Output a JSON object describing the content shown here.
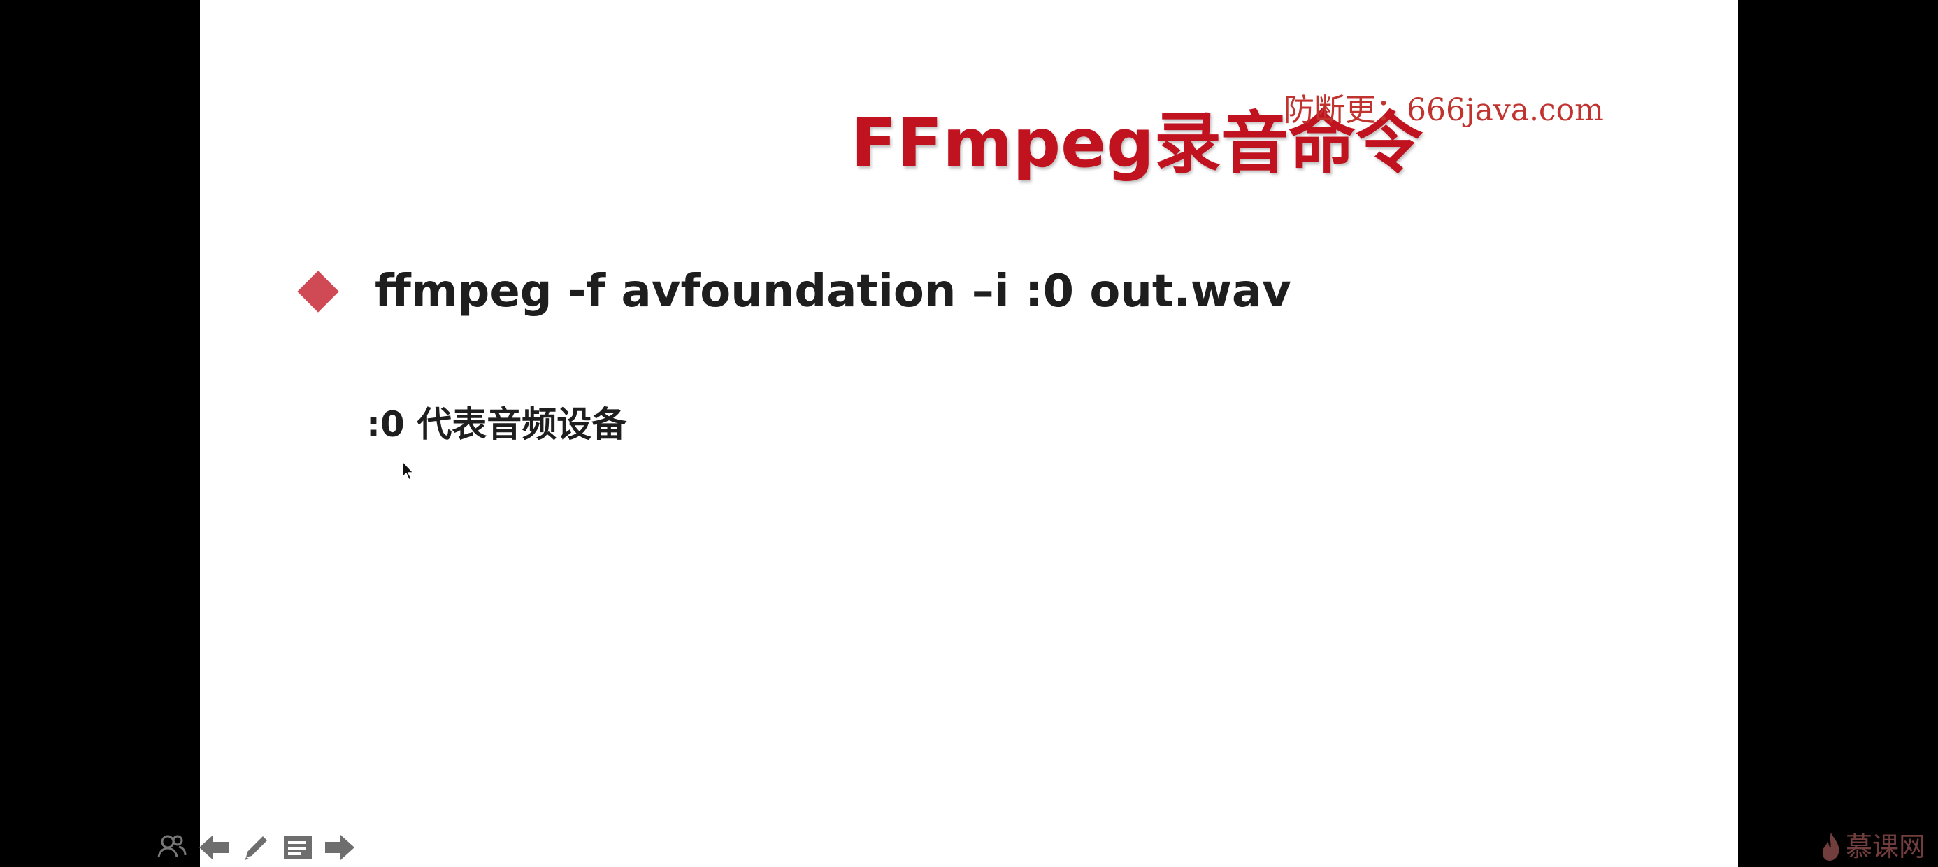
{
  "slide": {
    "title": "FFmpeg录音命令",
    "watermark": "防断更：666java.com",
    "bullets": [
      {
        "text": "ffmpeg -f avfoundation –i :0 out.wav"
      }
    ],
    "note": ":0 代表音频设备"
  },
  "toolbar": {
    "icons": [
      "people-icon",
      "previous-arrow-icon",
      "pen-icon",
      "menu-icon",
      "next-arrow-icon"
    ]
  },
  "brand": {
    "text": "慕课网",
    "icon": "flame-icon"
  },
  "colors": {
    "title": "#c0121f",
    "watermark": "#c0332e",
    "bullet": "#d04a55",
    "body_text": "#1e1e1e",
    "background": "#000000",
    "slide": "#ffffff"
  }
}
